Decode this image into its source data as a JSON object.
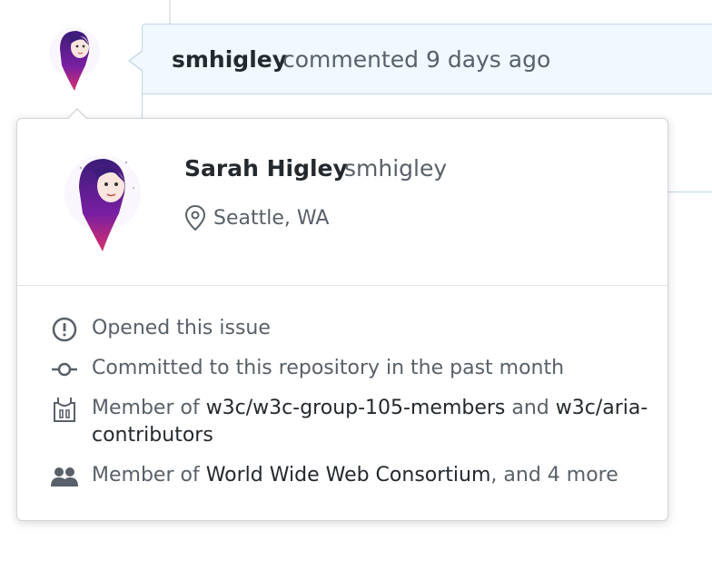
{
  "comment": {
    "author": "smhigley",
    "meta": "commented 9 days ago"
  },
  "hovercard": {
    "name": "Sarah Higley",
    "login": "smhigley",
    "location": "Seattle, WA",
    "rows": {
      "opened": "Opened this issue",
      "committed": "Committed to this repository in the past month",
      "member_teams": {
        "prefix": "Member of ",
        "team1": "w3c/w3c-group-105-members",
        "and": " and ",
        "team2_line1": "w3c/aria-",
        "team2_line2": "contributors"
      },
      "member_orgs": {
        "prefix": "Member of ",
        "org": "World Wide Web Consortium",
        "suffix": ", and 4 more"
      }
    }
  },
  "colors": {
    "header_bg": "#f1f8ff",
    "header_border": "#c0d3eb",
    "muted_text": "#586069",
    "dark_text": "#24292e"
  },
  "icons": [
    "avatar",
    "location-pin-icon",
    "issue-opened-icon",
    "git-commit-icon",
    "team-icon",
    "organization-icon"
  ]
}
